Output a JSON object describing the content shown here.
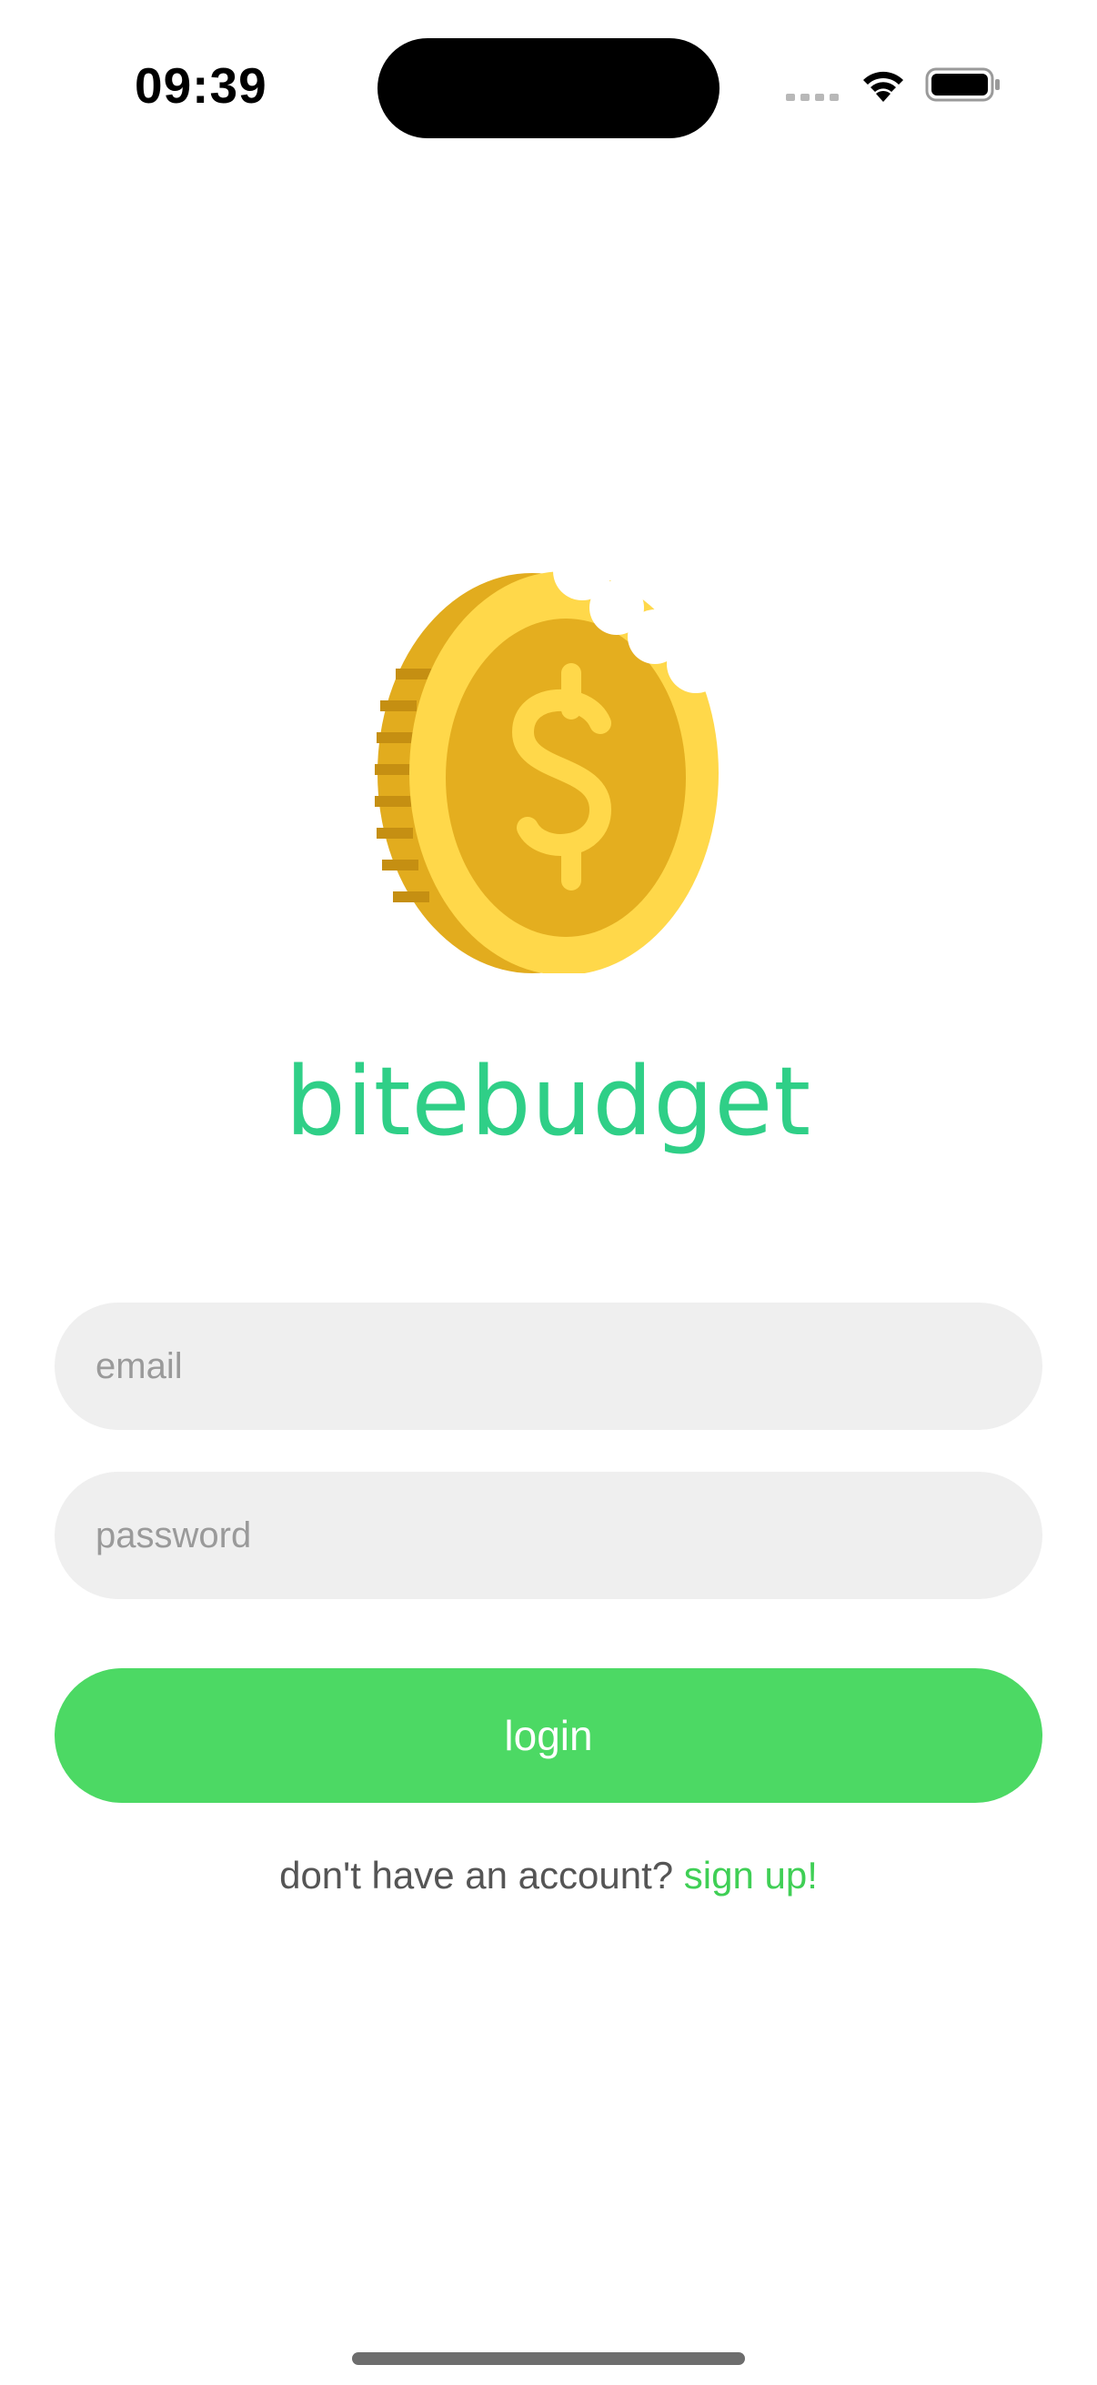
{
  "status_bar": {
    "time": "09:39",
    "icons": [
      "signal-icon",
      "wifi-icon",
      "battery-icon"
    ]
  },
  "branding": {
    "logo_icon": "bitten-coin-icon",
    "app_name": "bitebudget",
    "app_name_color": "#2fcf87"
  },
  "form": {
    "email_placeholder": "email",
    "email_value": "",
    "password_placeholder": "password",
    "password_value": "",
    "login_label": "login",
    "login_color": "#4cd964"
  },
  "signup": {
    "prompt": "don't have an account?",
    "link_label": "sign up!",
    "link_color": "#3fcf55"
  }
}
